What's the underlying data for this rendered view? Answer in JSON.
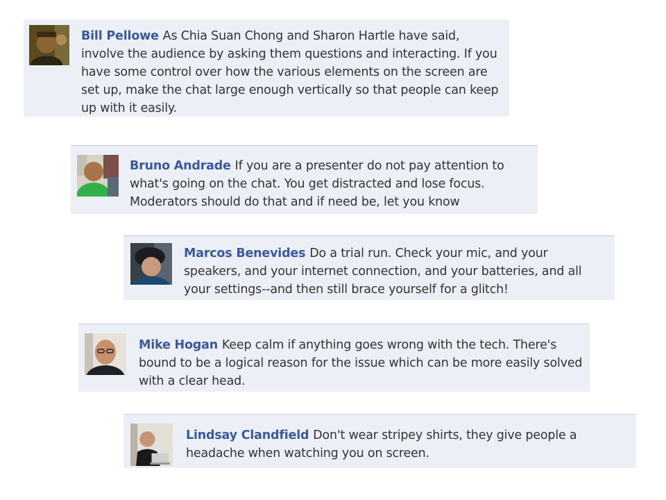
{
  "comments": [
    {
      "author": "Bill Pellowe",
      "text": "As Chia Suan Chong and Sharon Hartle have said, involve the audience by asking them questions and interacting. If you have some control over how the various elements on the screen are set up, make the chat large enough vertically so that people can keep up with it easily.",
      "avatar_icon": "profile-photo"
    },
    {
      "author": "Bruno Andrade",
      "text": "If you are a presenter do not pay attention to what's going on the chat. You get distracted and lose focus. Moderators should do that and if need be, let you know",
      "avatar_icon": "profile-photo"
    },
    {
      "author": "Marcos Benevides",
      "text": "Do a trial run. Check your mic, and your speakers, and your internet connection, and your batteries, and all your settings--and then still brace yourself for a glitch!",
      "avatar_icon": "profile-photo"
    },
    {
      "author": "Mike Hogan",
      "text": "Keep calm if anything goes wrong with the tech. There's bound to be a logical reason for the issue which can be more easily solved with a clear head.",
      "avatar_icon": "profile-photo"
    },
    {
      "author": "Lindsay Clandfield",
      "text": "Don't wear stripey shirts, they give people a headache when watching you on screen.",
      "avatar_icon": "profile-photo"
    }
  ],
  "colors": {
    "author_link": "#3b5998",
    "comment_bg": "#eceff5",
    "body_text": "#333333"
  }
}
